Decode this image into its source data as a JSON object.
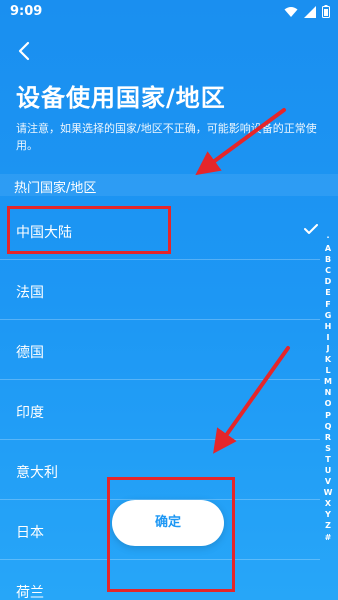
{
  "status": {
    "time": "9:09"
  },
  "header": {
    "title": "设备使用国家/地区",
    "notice": "请注意，如果选择的国家/地区不正确，可能影响设备的正常使用。"
  },
  "section": {
    "label": "热门国家/地区"
  },
  "countries": [
    {
      "name": "中国大陆",
      "selected": true
    },
    {
      "name": "法国",
      "selected": false
    },
    {
      "name": "德国",
      "selected": false
    },
    {
      "name": "印度",
      "selected": false
    },
    {
      "name": "意大利",
      "selected": false
    },
    {
      "name": "日本",
      "selected": false
    },
    {
      "name": "荷兰",
      "selected": false
    }
  ],
  "alphabet": [
    "·",
    "A",
    "B",
    "C",
    "D",
    "E",
    "F",
    "G",
    "H",
    "I",
    "J",
    "K",
    "L",
    "M",
    "N",
    "O",
    "P",
    "Q",
    "R",
    "S",
    "T",
    "U",
    "V",
    "W",
    "X",
    "Y",
    "Z",
    "#"
  ],
  "confirm_label": "确定",
  "colors": {
    "annotation": "#e5262a",
    "accent": "#1d97f4"
  },
  "icons": {
    "back": "chevron-left-icon",
    "check": "checkmark-icon"
  }
}
